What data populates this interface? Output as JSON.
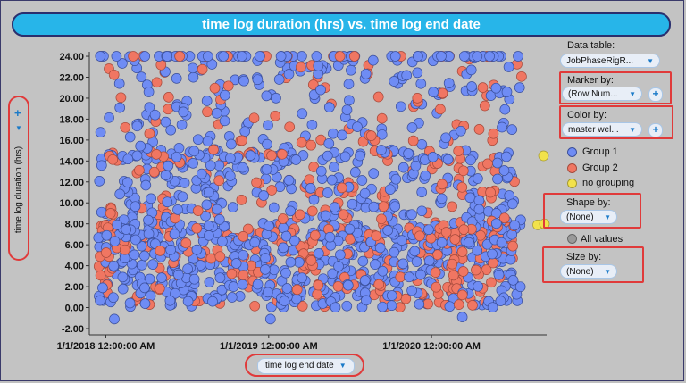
{
  "title": "time log duration (hrs) vs. time log end date",
  "y_axis": {
    "label": "time log duration (hrs)"
  },
  "x_axis": {
    "label": "time log end date"
  },
  "panel": {
    "data_table": {
      "label": "Data table:",
      "value": "JobPhaseRigR..."
    },
    "marker_by": {
      "label": "Marker by:",
      "value": "(Row Num..."
    },
    "color_by": {
      "label": "Color by:",
      "value": "master wel..."
    },
    "legend": [
      {
        "name": "Group 1",
        "color": "#6f8cf4"
      },
      {
        "name": "Group 2",
        "color": "#f07662"
      },
      {
        "name": "no grouping",
        "color": "#f2e24b"
      }
    ],
    "shape_by": {
      "label": "Shape by:",
      "value": "(None)"
    },
    "shape_legend": {
      "name": "All values",
      "color": "#9a9a9a"
    },
    "size_by": {
      "label": "Size by:",
      "value": "(None)"
    }
  },
  "colors": {
    "group1": "#6f8cf4",
    "group2": "#f07662",
    "no_grouping": "#f2e24b",
    "title_bar": "#27b5e9",
    "highlight": "#e03a3a"
  },
  "chart_data": {
    "type": "scatter",
    "title": "time log duration (hrs) vs. time log end date",
    "xlabel": "time log end date",
    "ylabel": "time log duration (hrs)",
    "x_ticks": [
      "1/1/2018 12:00:00 AM",
      "1/1/2019 12:00:00 AM",
      "1/1/2020 12:00:00 AM"
    ],
    "y_ticks": [
      "24.00",
      "22.00",
      "20.00",
      "18.00",
      "16.00",
      "14.00",
      "12.00",
      "10.00",
      "8.00",
      "6.00",
      "4.00",
      "2.00",
      "0.00",
      "-2.00"
    ],
    "xlim": [
      "2017-11-25",
      "2020-09-15"
    ],
    "ylim": [
      -2.6,
      24.6
    ],
    "series": [
      {
        "name": "Group 1",
        "color": "#6f8cf4"
      },
      {
        "name": "Group 2",
        "color": "#f07662"
      },
      {
        "name": "no grouping",
        "color": "#f2e24b"
      }
    ],
    "sample_points": [
      {
        "series": "no grouping",
        "x": "2020-09-08",
        "y": 14.5
      },
      {
        "series": "no grouping",
        "x": "2020-08-26",
        "y": 7.9
      },
      {
        "series": "no grouping",
        "x": "2020-09-10",
        "y": 8.0
      },
      {
        "series": "Group 1",
        "x": "2018-01-20",
        "y": -1.1
      },
      {
        "series": "Group 1",
        "x": "2019-01-05",
        "y": -1.1
      },
      {
        "series": "Group 1",
        "x": "2020-03-10",
        "y": -0.9
      }
    ]
  }
}
